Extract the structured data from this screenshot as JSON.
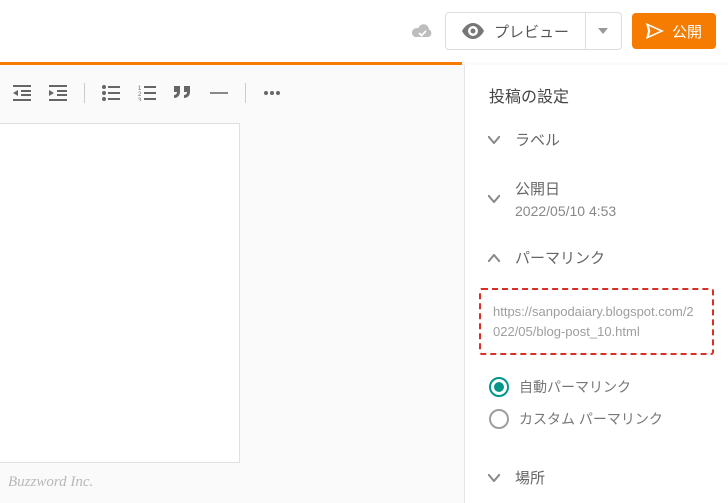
{
  "topbar": {
    "preview_label": "プレビュー",
    "publish_label": "公開"
  },
  "sidebar": {
    "title": "投稿の設定",
    "label_section": "ラベル",
    "publish_date_label": "公開日",
    "publish_date_value": "2022/05/10 4:53",
    "permalink_label": "パーマリンク",
    "permalink_url": "https://sanpodaiary.blogspot.com/2022/05/blog-post_10.html",
    "permalink_auto": "自動パーマリンク",
    "permalink_custom": "カスタム パーマリンク",
    "location_label": "場所"
  },
  "watermark": "Buzzword Inc."
}
